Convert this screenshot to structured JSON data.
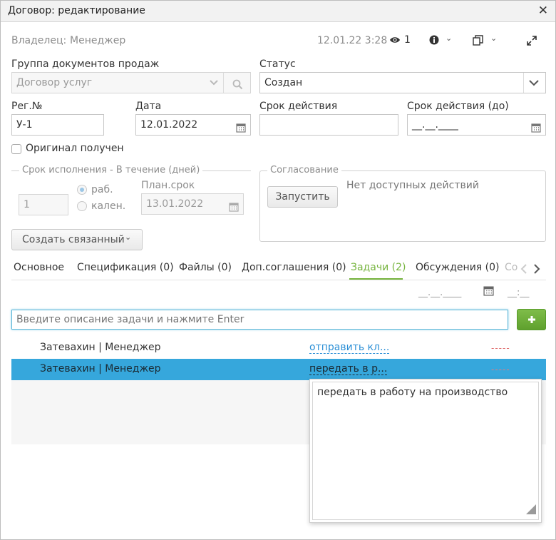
{
  "window": {
    "title": "Договор: редактирование"
  },
  "header": {
    "owner_label": "Владелец:",
    "owner_value": "Менеджер",
    "timestamp": "12.01.22 3:28",
    "views_count": "1"
  },
  "fields": {
    "group_label": "Группа документов продаж",
    "group_placeholder": "Договор услуг",
    "status_label": "Статус",
    "status_value": "Создан",
    "reg_label": "Рег.№",
    "reg_value": "У-1",
    "date_label": "Дата",
    "date_value": "12.01.2022",
    "validity_label": "Срок действия",
    "validity_value": "",
    "validity_until_label": "Срок действия (до)",
    "validity_until_value": "__.__.____",
    "original_label": "Оригинал получен"
  },
  "execution": {
    "legend": "Срок исполнения - В течение (дней)",
    "days_value": "1",
    "radio_work": "раб.",
    "radio_calendar": "кален.",
    "plan_label": "План.срок",
    "plan_value": "13.01.2022"
  },
  "approval": {
    "legend": "Согласование",
    "start_button": "Запустить",
    "no_actions": "Нет доступных действий"
  },
  "create_linked_button": "Создать связанный",
  "tabs": [
    {
      "label": "Основное"
    },
    {
      "label": "Спецификация (0)"
    },
    {
      "label": "Файлы (0)"
    },
    {
      "label": "Доп.соглашения (0)"
    },
    {
      "label": "Задачи (2)"
    },
    {
      "label": "Обсуждения (0)"
    },
    {
      "label": "Со"
    }
  ],
  "tasks": {
    "date_placeholder": "__.__.____",
    "time_placeholder": "__:__",
    "input_placeholder": "Введите описание задачи и нажмите Enter",
    "rows": [
      {
        "assignee": "Затевахин | Менеджер",
        "task": "отправить кл...",
        "deadline": "-----"
      },
      {
        "assignee": "Затевахин | Менеджер",
        "task": "передать в р...",
        "deadline": "-----"
      }
    ],
    "popup_text": "передать в работу на производство"
  },
  "colors": {
    "accent_green": "#6dae3a",
    "selected_row": "#36a7dc",
    "active_tab": "#76b43e",
    "link_blue": "#2b8fd6"
  }
}
